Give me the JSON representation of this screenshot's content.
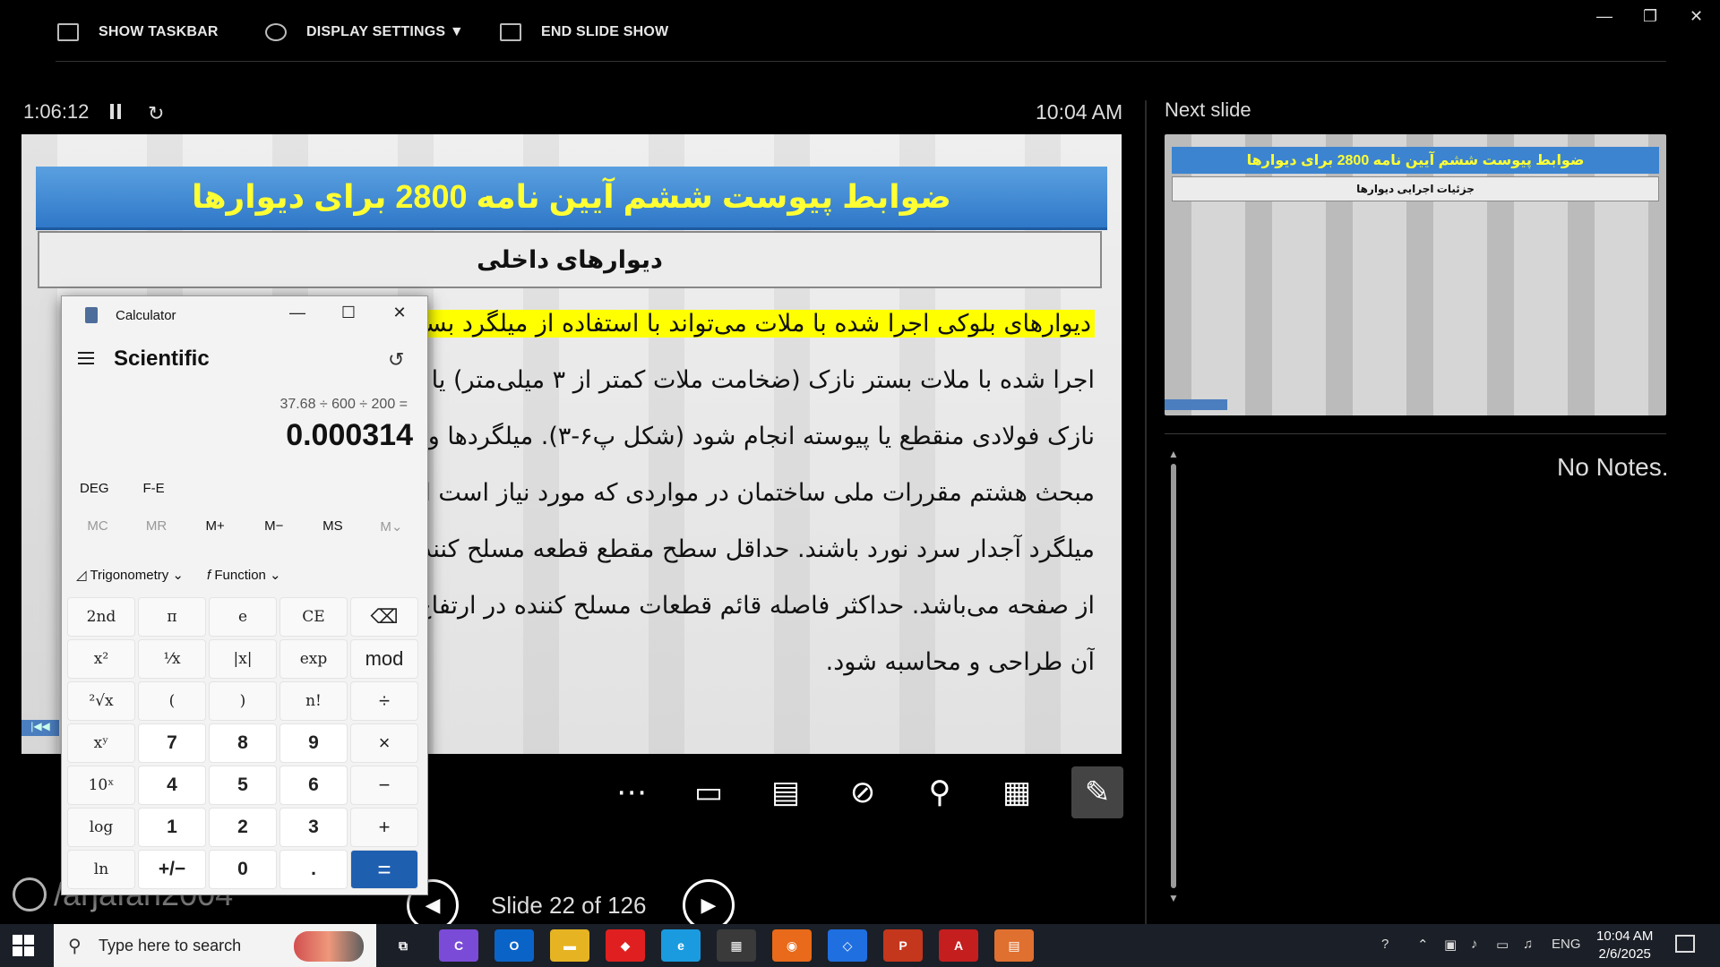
{
  "toolbar": {
    "show_taskbar": "SHOW TASKBAR",
    "display_settings": "DISPLAY SETTINGS ▼",
    "end_slide_show": "END SLIDE SHOW"
  },
  "timer": {
    "elapsed": "1:06:12",
    "clock": "10:04 AM"
  },
  "slide": {
    "title": "ضوابط پیوست ششم آیین نامه 2800 برای دیوارها",
    "subtitle": "دیوارهای داخلی",
    "lines": [
      "دیوارهای بلوکی اجرا شده با ملات می‌تواند با استفاده از میلگرد بستر خرپایی",
      "اجرا شده با ملات بستر نازک (ضخامت ملات کمتر از ۳ میلی‌متر) یا چسب",
      "نازک فولادی منقطع یا پیوسته انجام شود (شکل پ۶-۳). میلگردها و بستها",
      "مبحث هشتم مقررات ملی ساختمان در مواردی که مورد نیاز است از جنس",
      "میلگرد آجدار سرد نورد باشند. حداقل سطح مقطع قطعه مسلح کننده ۰۰۰۳",
      "از صفحه می‌باشد. حداکثر فاصله قائم قطعات مسلح کننده در ارتفاع دیوار",
      "آن طراحی و محاسبه شود."
    ]
  },
  "nav": {
    "slide_counter": "Slide 22 of 126"
  },
  "next_slide": {
    "label": "Next slide",
    "title": "ضوابط پیوست ششم آیین نامه 2800 برای دیوارها",
    "subtitle": "جزئیات اجرایی دیوارها"
  },
  "notes": {
    "text": "No Notes."
  },
  "watermark": {
    "text": "/arjafari2004"
  },
  "calculator": {
    "app_name": "Calculator",
    "mode": "Scientific",
    "expression": "37.68 ÷ 600 ÷ 200 =",
    "result": "0.000314",
    "angle_unit": "DEG",
    "fe": "F-E",
    "memory": [
      "MC",
      "MR",
      "M+",
      "M−",
      "MS",
      "M⌄"
    ],
    "trig_label": "Trigonometry",
    "function_label": "Function",
    "keys": [
      [
        "2nd",
        "π",
        "e",
        "CE",
        "⌫"
      ],
      [
        "x²",
        "¹⁄x",
        "|x|",
        "exp",
        "mod"
      ],
      [
        "²√x",
        "(",
        ")",
        "n!",
        "÷"
      ],
      [
        "xʸ",
        "7",
        "8",
        "9",
        "×"
      ],
      [
        "10ˣ",
        "4",
        "5",
        "6",
        "−"
      ],
      [
        "log",
        "1",
        "2",
        "3",
        "+"
      ],
      [
        "ln",
        "+/−",
        "0",
        ".",
        "="
      ]
    ]
  },
  "taskbar": {
    "search_placeholder": "Type here to search",
    "language": "ENG",
    "time": "10:04 AM",
    "date": "2/6/2025"
  }
}
